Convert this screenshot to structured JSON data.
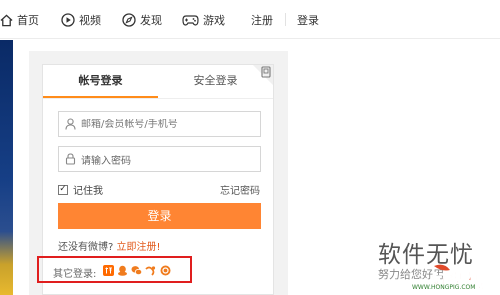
{
  "nav": {
    "home": "首页",
    "video": "视频",
    "discover": "发现",
    "games": "游戏",
    "register": "注册",
    "login": "登录"
  },
  "login_card": {
    "tab_account": "帐号登录",
    "tab_secure": "安全登录",
    "username_placeholder": "邮箱/会员帐号/手机号",
    "password_value": "请输入密码",
    "remember_me": "记住我",
    "forgot_password": "忘记密码",
    "login_button": "登录",
    "no_weibo": "还没有微博?",
    "register_now": "立即注册!",
    "other_login": "其它登录:",
    "other_login_icons": [
      "taobao-icon",
      "qq-icon",
      "weixin-icon",
      "alipay-icon",
      "360-icon"
    ]
  },
  "watermark": {
    "title": "软件无忧",
    "subtitle": "努力给您好用",
    "logo_text": "好装机",
    "url": "WWW.HONGPIG.COM"
  },
  "colors": {
    "accent": "#ff8533",
    "highlight_box": "#e01e1e",
    "register_link": "#e25a1c"
  }
}
